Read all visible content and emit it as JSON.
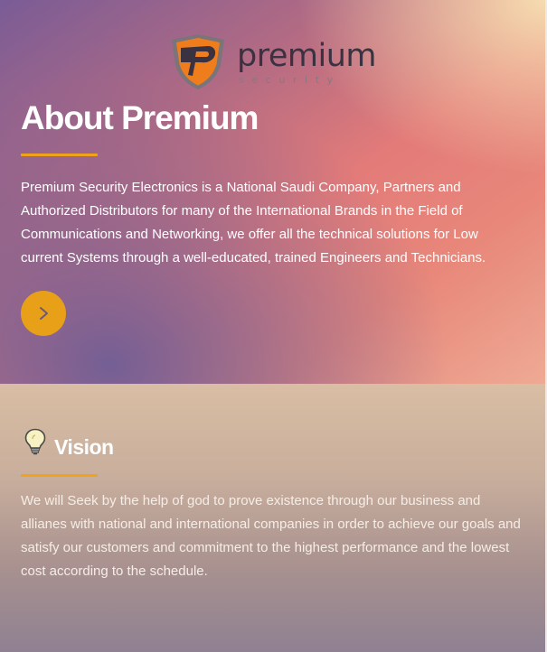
{
  "logo": {
    "wordmark": "premium",
    "subtext": "security",
    "colors": {
      "shield_gray": "#7b7479",
      "shield_orange": "#f07d1c",
      "wordmark": "#3a3240"
    }
  },
  "about": {
    "title": "About Premium",
    "body": "Premium Security Electronics is a National Saudi Company, Partners and Authorized Distributors for many of the International Brands in the Field of Communications and Networking, we offer all the technical solutions for Low current Systems through a well-educated, trained Engineers and Technicians.",
    "button_icon": "chevron-right-icon"
  },
  "vision": {
    "icon": "lightbulb-icon",
    "title": "Vision",
    "body": "We will Seek by the help of god to prove existence through our business and allianes with national and international companies in order to achieve our goals and satisfy our customers and commitment to the highest performance and the lowest cost according to the schedule."
  },
  "colors": {
    "accent": "#e8a018",
    "underline": "#f0a21a",
    "text": "#ffffff"
  }
}
